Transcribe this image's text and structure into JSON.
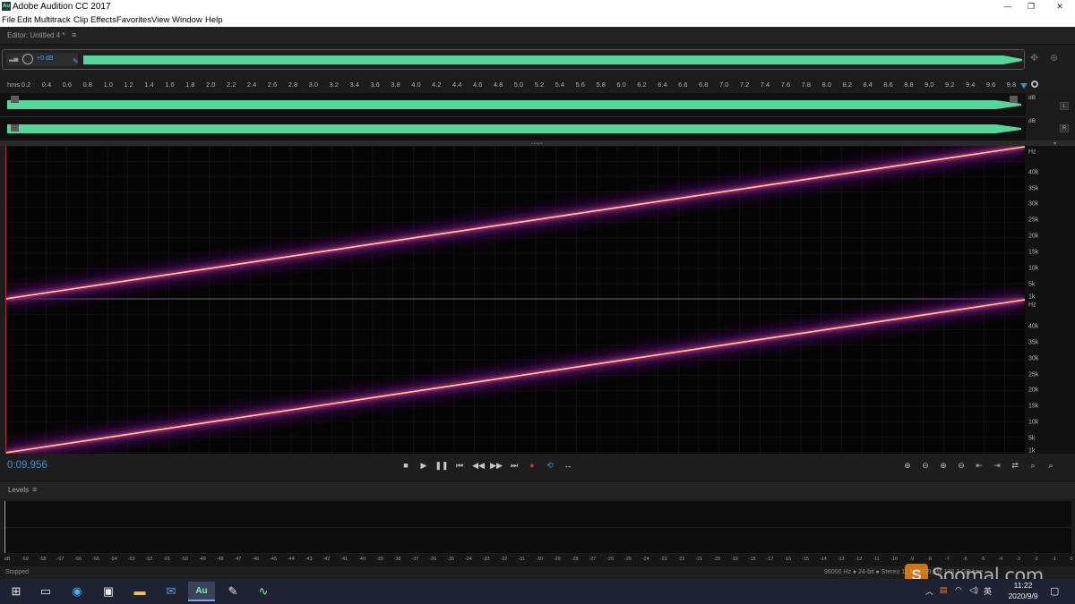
{
  "window": {
    "title": "Adobe Audition CC 2017",
    "app_icon": "Au",
    "minimize": "—",
    "maximize": "❐",
    "close": "✕"
  },
  "menu": [
    "File",
    "Edit",
    "Multitrack",
    "Clip",
    "Effects",
    "Favorites",
    "View",
    "Window",
    "Help"
  ],
  "editor": {
    "title": "Editor: Untitled 4 *"
  },
  "overview": {
    "gain_db": "+0 dB"
  },
  "ruler": {
    "unit": "hms",
    "ticks": [
      "0.2",
      "0.4",
      "0.6",
      "0.8",
      "1.0",
      "1.2",
      "1.4",
      "1.6",
      "1.8",
      "2.0",
      "2.2",
      "2.4",
      "2.6",
      "2.8",
      "3.0",
      "3.2",
      "3.4",
      "3.6",
      "3.8",
      "4.0",
      "4.2",
      "4.4",
      "4.6",
      "4.8",
      "5.0",
      "5.2",
      "5.4",
      "5.6",
      "5.8",
      "6.0",
      "6.2",
      "6.4",
      "6.6",
      "6.8",
      "7.0",
      "7.2",
      "7.4",
      "7.6",
      "7.8",
      "8.0",
      "8.2",
      "8.4",
      "8.6",
      "8.8",
      "9.0",
      "9.2",
      "9.4",
      "9.6",
      "9.8"
    ]
  },
  "channels": {
    "left": {
      "letter": "L",
      "db_label": "dB"
    },
    "right": {
      "letter": "R",
      "db_label": "dB"
    }
  },
  "frequency_axis": {
    "unit": "Hz",
    "labels": [
      "40k",
      "35k",
      "30k",
      "25k",
      "20k",
      "15k",
      "10k",
      "5k",
      "1k"
    ]
  },
  "transport": {
    "timecode": "0:09.956",
    "buttons": [
      "stop",
      "play",
      "pause",
      "to-start",
      "rewind",
      "fast-forward",
      "to-end",
      "record",
      "loop",
      "skip-selection"
    ],
    "symbols": [
      "■",
      "▶",
      "❚❚",
      "⏮",
      "◀◀",
      "▶▶",
      "⏭",
      "●",
      "⟲",
      "↔"
    ],
    "record_color": "#e02828",
    "loop_color": "#3a8fe0"
  },
  "zoom_tools": [
    "⊕",
    "⊖",
    "⊕",
    "⊖",
    "⇤",
    "⇥",
    "⇄"
  ],
  "levels": {
    "title": "Levels",
    "scale": [
      "dB",
      "-59",
      "-58",
      "-57",
      "-56",
      "-55",
      "-54",
      "-53",
      "-52",
      "-51",
      "-50",
      "-49",
      "-48",
      "-47",
      "-46",
      "-45",
      "-44",
      "-43",
      "-42",
      "-41",
      "-40",
      "-39",
      "-38",
      "-37",
      "-36",
      "-35",
      "-34",
      "-33",
      "-32",
      "-31",
      "-30",
      "-29",
      "-28",
      "-27",
      "-26",
      "-25",
      "-24",
      "-23",
      "-22",
      "-21",
      "-20",
      "-19",
      "-18",
      "-17",
      "-16",
      "-15",
      "-14",
      "-13",
      "-12",
      "-11",
      "-10",
      "-9",
      "-8",
      "-7",
      "-6",
      "-5",
      "-4",
      "-3",
      "-2",
      "-1",
      "0"
    ]
  },
  "status": {
    "state": "Stopped",
    "info": "96000 Hz ● 24-bit ● Stereo   11 MB   289.5%   178.1 GB free"
  },
  "taskbar": {
    "time": "11:22",
    "date": "2020/9/9",
    "ime": "英",
    "apps": [
      "windows",
      "task-view",
      "edge",
      "store",
      "explorer",
      "mail",
      "audition",
      "sketch",
      "activity"
    ]
  },
  "watermark": {
    "logo": "S",
    "text": "Soomal.com"
  },
  "colors": {
    "waveform": "#56d69b",
    "accent": "#3a8fe0",
    "sweep": "#ffd59a",
    "background": "#1d1d1d"
  }
}
